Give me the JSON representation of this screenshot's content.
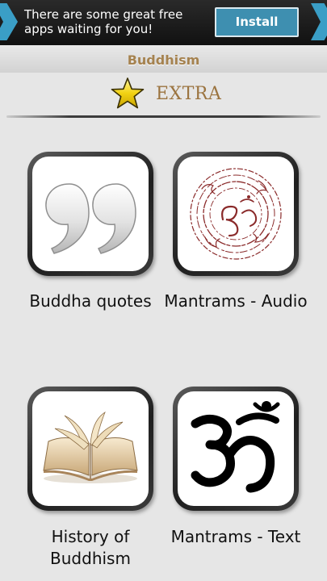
{
  "ad": {
    "text": "There are some great free apps waiting for you!",
    "install_label": "Install"
  },
  "header": {
    "title": "Buddhism"
  },
  "section": {
    "title": "EXTRA",
    "icon": "star-icon"
  },
  "tiles": [
    {
      "label": "Buddha quotes",
      "icon": "quote-marks-icon"
    },
    {
      "label": "Mantrams - Audio",
      "icon": "mantra-circle-icon"
    },
    {
      "label": "History of Buddhism",
      "icon": "open-book-icon"
    },
    {
      "label": "Mantrams - Text",
      "icon": "om-symbol-icon"
    }
  ],
  "colors": {
    "ad_background": "#1a1a1a",
    "ad_accent": "#3a9ec6",
    "title_color": "#a5824f",
    "background": "#e6e6e6"
  }
}
